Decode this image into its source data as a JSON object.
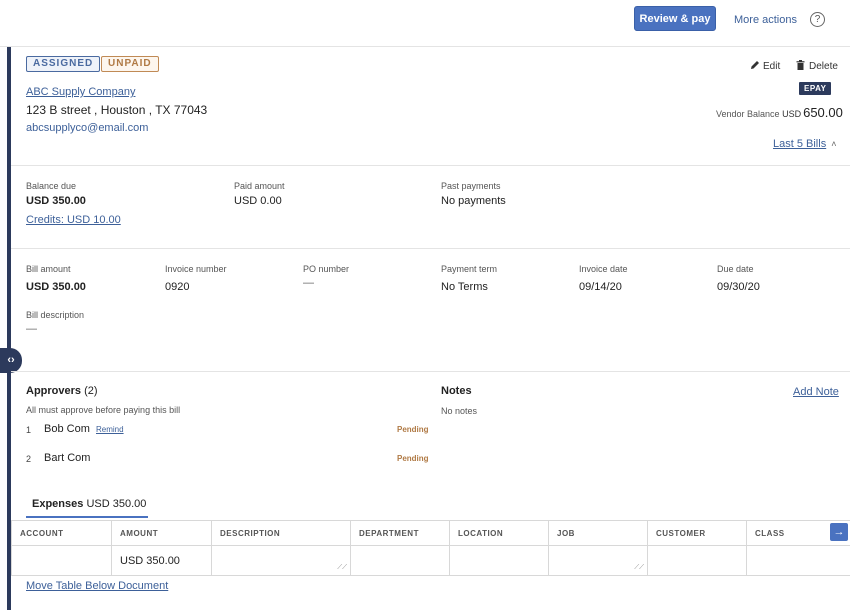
{
  "header": {
    "review_pay_label": "Review & pay",
    "more_actions_label": "More actions",
    "help_glyph": "?"
  },
  "status": {
    "assigned": "ASSIGNED",
    "unpaid": "UNPAID"
  },
  "actions": {
    "edit_label": "Edit",
    "delete_label": "Delete"
  },
  "epay_label": "EPAY",
  "vendor": {
    "name": "ABC Supply Company",
    "address": "123 B street , Houston , TX 77043",
    "email": "abcsupplyco@email.com",
    "balance_label": "Vendor Balance",
    "balance_currency": "USD",
    "balance_amount": "650.00",
    "last_bills_label": "Last 5 Bills"
  },
  "summary": {
    "balance_due_label": "Balance due",
    "balance_due_value": "USD 350.00",
    "credits_link": "Credits: USD 10.00",
    "paid_amount_label": "Paid amount",
    "paid_amount_value": "USD 0.00",
    "past_payments_label": "Past payments",
    "past_payments_value": "No payments"
  },
  "details": {
    "bill_amount_label": "Bill amount",
    "bill_amount_value": "USD 350.00",
    "invoice_number_label": "Invoice number",
    "invoice_number_value": "0920",
    "po_number_label": "PO number",
    "po_number_value": "—",
    "payment_term_label": "Payment term",
    "payment_term_value": "No Terms",
    "invoice_date_label": "Invoice date",
    "invoice_date_value": "09/14/20",
    "due_date_label": "Due date",
    "due_date_value": "09/30/20",
    "bill_description_label": "Bill description",
    "bill_description_value": "—"
  },
  "approvers": {
    "title": "Approvers",
    "count": "(2)",
    "note": "All must approve before paying this bill",
    "items": [
      {
        "num": "1",
        "name": "Bob Com",
        "remind": "Remind",
        "status": "Pending"
      },
      {
        "num": "2",
        "name": "Bart Com",
        "remind": "",
        "status": "Pending"
      }
    ]
  },
  "notes": {
    "title": "Notes",
    "empty": "No notes",
    "add_note": "Add Note"
  },
  "expenses": {
    "tab_label": "Expenses",
    "tab_amount": "USD 350.00",
    "columns": [
      "ACCOUNT",
      "AMOUNT",
      "DESCRIPTION",
      "DEPARTMENT",
      "LOCATION",
      "JOB",
      "CUSTOMER",
      "CLASS"
    ],
    "row": {
      "account": "",
      "amount": "USD 350.00",
      "description": "",
      "department": "",
      "location": "",
      "job": "",
      "customer": "",
      "class": ""
    },
    "move_table_label": "Move Table Below Document"
  },
  "icons": {
    "collapse": "chevrons-icon",
    "edit": "pencil-icon",
    "delete": "trash-icon",
    "scroll_right": "arrow-right-icon",
    "help": "help-circle-icon"
  },
  "colors": {
    "primary": "#4a72c0",
    "nav_dark": "#2c3a5c",
    "link": "#3d6099",
    "pending": "#b07a45"
  }
}
